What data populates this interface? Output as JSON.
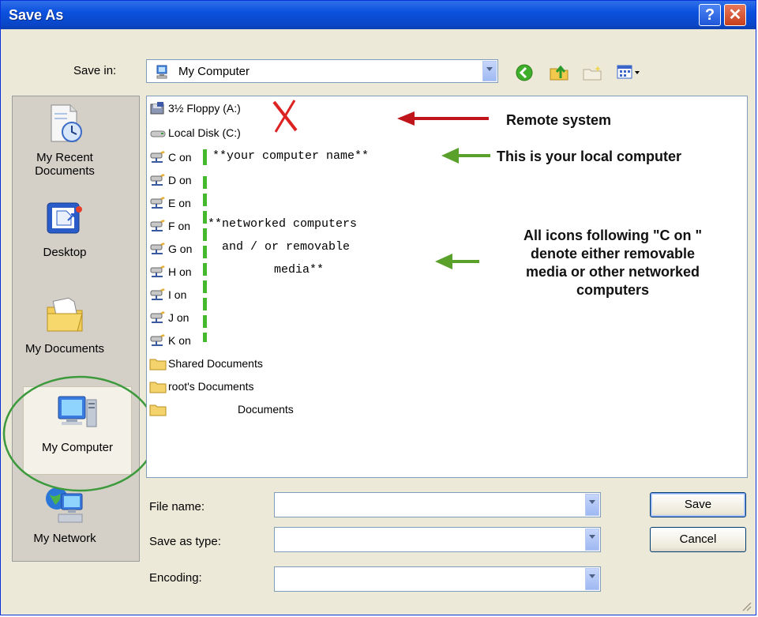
{
  "window": {
    "title": "Save As",
    "help_glyph": "?",
    "close_glyph": "✕"
  },
  "toolbar": {
    "save_in_label": "Save in:",
    "location": "My Computer",
    "icons": [
      "back-icon",
      "up-folder-icon",
      "new-folder-icon",
      "view-menu-icon"
    ]
  },
  "places": [
    {
      "label_line1": "My Recent",
      "label_line2": "Documents",
      "icon": "recent-documents-icon"
    },
    {
      "label_line1": "Desktop",
      "label_line2": "",
      "icon": "desktop-icon"
    },
    {
      "label_line1": "My Documents",
      "label_line2": "",
      "icon": "my-documents-icon"
    },
    {
      "label_line1": "My Computer",
      "label_line2": "",
      "icon": "my-computer-icon"
    },
    {
      "label_line1": "My Network",
      "label_line2": "",
      "icon": "my-network-icon"
    }
  ],
  "files": [
    {
      "label": "3½ Floppy (A:)",
      "type": "floppy"
    },
    {
      "label": "Local Disk (C:)",
      "type": "disk"
    },
    {
      "label": "C on",
      "type": "netdrive"
    },
    {
      "label": "D on",
      "type": "netdrive"
    },
    {
      "label": "E on",
      "type": "netdrive"
    },
    {
      "label": "F on",
      "type": "netdrive"
    },
    {
      "label": "G on",
      "type": "netdrive"
    },
    {
      "label": "H on",
      "type": "netdrive"
    },
    {
      "label": "I on",
      "type": "netdrive"
    },
    {
      "label": "J on",
      "type": "netdrive"
    },
    {
      "label": "K on",
      "type": "netdrive"
    },
    {
      "label": "Shared Documents",
      "type": "folder"
    },
    {
      "label": "root's Documents",
      "type": "folder"
    },
    {
      "label": "Documents",
      "type": "folder"
    }
  ],
  "annotations": {
    "computer_name": "**your computer name**",
    "networked_1": "**networked computers",
    "networked_2": "and / or removable",
    "networked_3": "media**",
    "remote_system": "Remote system",
    "local_computer": "This is your local computer",
    "icons_note_1": "All icons following \"C on \"",
    "icons_note_2": "denote either removable",
    "icons_note_3": "media or other networked",
    "icons_note_4": "computers",
    "arrow_colors": {
      "remote": "#c0161b",
      "local": "#5aa12b"
    }
  },
  "form": {
    "file_name_label": "File name:",
    "file_name_value": "",
    "save_type_label": "Save as type:",
    "save_type_value": "",
    "encoding_label": "Encoding:",
    "encoding_value": ""
  },
  "buttons": {
    "save": "Save",
    "cancel": "Cancel"
  }
}
